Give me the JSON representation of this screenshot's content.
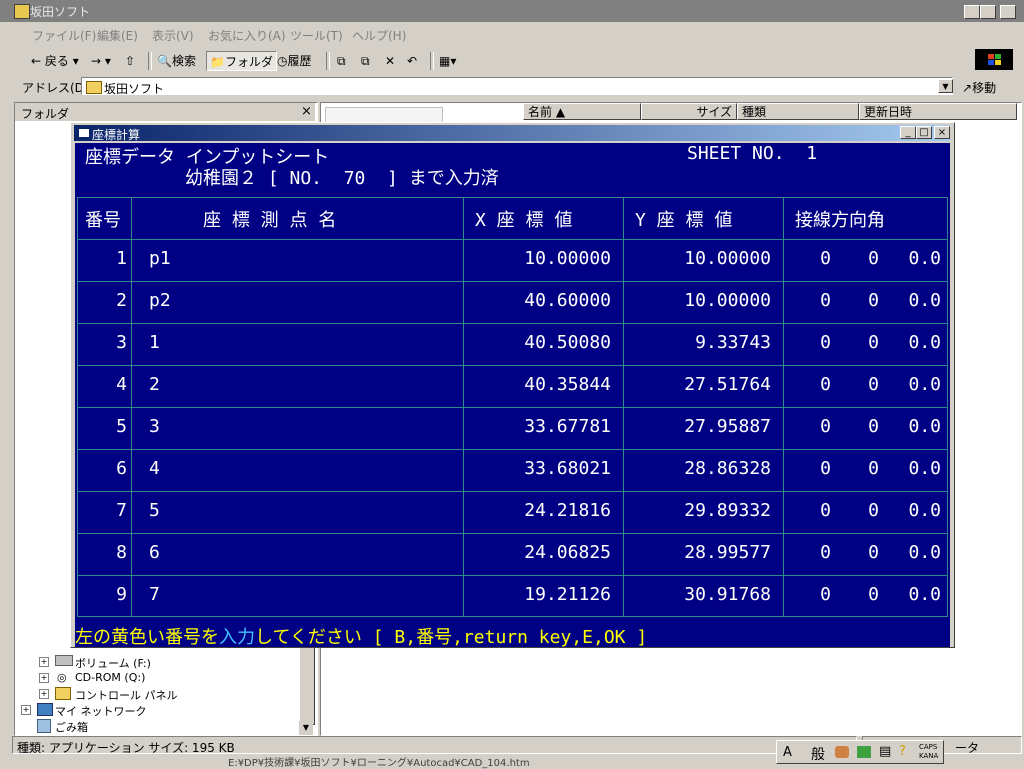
{
  "window": {
    "title": "坂田ソフト"
  },
  "menu": [
    "ファイル(F)",
    "編集(E)",
    "表示(V)",
    "お気に入り(A)",
    "ツール(T)",
    "ヘルプ(H)"
  ],
  "toolbar": {
    "back": "戻る",
    "search": "検索",
    "folders": "フォルダ",
    "history": "履歴"
  },
  "address": {
    "label": "アドレス(D)",
    "value": "坂田ソフト",
    "go": "移動"
  },
  "folder_pane": {
    "title": "フォルダ",
    "tree": [
      "ボリューム (F:)",
      "CD-ROM (Q:)",
      "コントロール パネル",
      "マイ ネットワーク",
      "ごみ箱"
    ]
  },
  "columns": [
    "名前",
    "サイズ",
    "種類",
    "更新日時"
  ],
  "status": {
    "text": "種類: アプリケーション サイズ: 195 KB",
    "path": "E:¥DP¥技術課¥坂田ソフト¥ローニング¥Autocad¥CAD_104.htm",
    "right": "ータ"
  },
  "dialog": {
    "title": "座標計算",
    "heading": "座標データ インプットシート",
    "sheet": "SHEET NO.  1",
    "subtitle": "幼稚園２ [ NO.  70  ] まで入力済",
    "headers": [
      "番号",
      "座 標 測 点 名",
      "X 座 標 値",
      "Y 座 標 値",
      "接線方向角"
    ],
    "rows": [
      {
        "no": "1",
        "name": "p1",
        "x": "10.00000",
        "y": "10.00000",
        "a1": "0",
        "a2": "0",
        "a3": "0.0"
      },
      {
        "no": "2",
        "name": "p2",
        "x": "40.60000",
        "y": "10.00000",
        "a1": "0",
        "a2": "0",
        "a3": "0.0"
      },
      {
        "no": "3",
        "name": "1",
        "x": "40.50080",
        "y": "9.33743",
        "a1": "0",
        "a2": "0",
        "a3": "0.0"
      },
      {
        "no": "4",
        "name": "2",
        "x": "40.35844",
        "y": "27.51764",
        "a1": "0",
        "a2": "0",
        "a3": "0.0"
      },
      {
        "no": "5",
        "name": "3",
        "x": "33.67781",
        "y": "27.95887",
        "a1": "0",
        "a2": "0",
        "a3": "0.0"
      },
      {
        "no": "6",
        "name": "4",
        "x": "33.68021",
        "y": "28.86328",
        "a1": "0",
        "a2": "0",
        "a3": "0.0"
      },
      {
        "no": "7",
        "name": "5",
        "x": "24.21816",
        "y": "29.89332",
        "a1": "0",
        "a2": "0",
        "a3": "0.0"
      },
      {
        "no": "8",
        "name": "6",
        "x": "24.06825",
        "y": "28.99577",
        "a1": "0",
        "a2": "0",
        "a3": "0.0"
      },
      {
        "no": "9",
        "name": "7",
        "x": "19.21126",
        "y": "30.91768",
        "a1": "0",
        "a2": "0",
        "a3": "0.0"
      }
    ],
    "prompt_a": "左の黄色い番号を",
    "prompt_b": "入力",
    "prompt_c": "してください [ B,番号,return key,E,OK ]"
  },
  "ime": {
    "mode": "般",
    "caps": "CAPS",
    "kana": "KANA"
  }
}
